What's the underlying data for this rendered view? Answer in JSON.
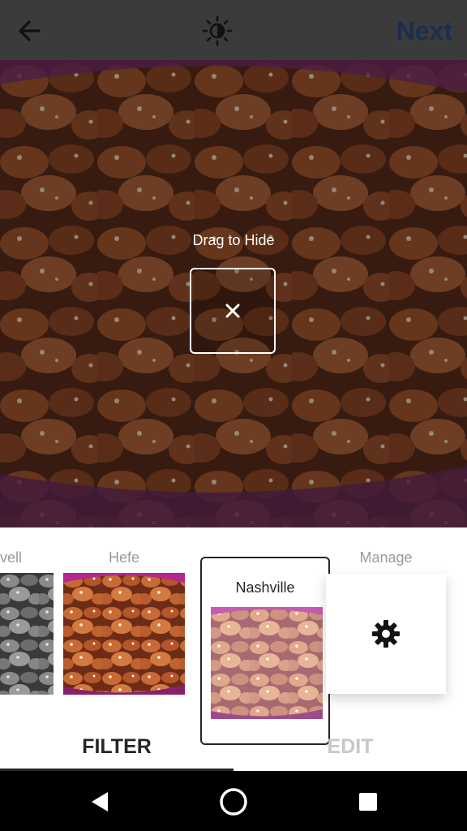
{
  "header": {
    "next_label": "Next",
    "icons": [
      "back-arrow-icon",
      "lux-brightness-icon"
    ]
  },
  "overlay": {
    "drag_label": "Drag to Hide",
    "icon": "close-icon"
  },
  "filters": [
    {
      "label": "vell",
      "style": "grayscale"
    },
    {
      "label": "Hefe",
      "style": "vivid"
    },
    {
      "label": "Nashville",
      "style": "pink-faded",
      "selected": true
    },
    {
      "label": "Manage",
      "icon": "gear-icon"
    }
  ],
  "tabs": {
    "filter": "FILTER",
    "edit": "EDIT",
    "active": "filter"
  },
  "system_nav": [
    "back-triangle-icon",
    "home-circle-icon",
    "recents-square-icon"
  ],
  "colors": {
    "topbar": "#3b3b3b",
    "next_text": "#1a2f4d",
    "active_tab": "#262626",
    "inactive_tab": "#c7c7c7",
    "nav_bar": "#000000"
  }
}
